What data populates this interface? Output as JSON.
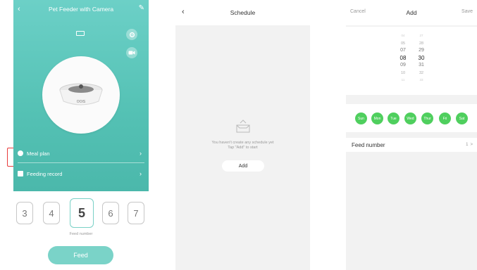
{
  "screen1": {
    "title": "Pet Feeder with Camera",
    "bowl_brand": "OOIS",
    "menu": [
      {
        "label": "Meal plan",
        "chevron": "›"
      },
      {
        "label": "Feeding record",
        "chevron": "›"
      }
    ],
    "numbers": [
      "3",
      "4",
      "5",
      "6",
      "7"
    ],
    "feed_number_label": "Feed number",
    "feed_button": "Feed"
  },
  "screen2": {
    "title": "Schedule",
    "empty_line1": "You haven't create any schedule yet",
    "empty_line2": "Tap \"Add\" to start",
    "add_button": "Add"
  },
  "screen3": {
    "cancel": "Cancel",
    "title": "Add",
    "save": "Save",
    "hours": [
      "04",
      "05",
      "07",
      "08",
      "09",
      "10",
      "11"
    ],
    "minutes": [
      "27",
      "28",
      "29",
      "30",
      "31",
      "32",
      "33"
    ],
    "days": [
      "Sun",
      "Mon",
      "Tue",
      "Wed",
      "Thur",
      "Fri",
      "Sat"
    ],
    "feed_number_label": "Feed number",
    "feed_number_value": "1",
    "feed_number_chevron": ">"
  },
  "colors": {
    "teal": "#54c1b4",
    "day_green": "#4fcf5e",
    "highlight": "#e83c3c"
  }
}
